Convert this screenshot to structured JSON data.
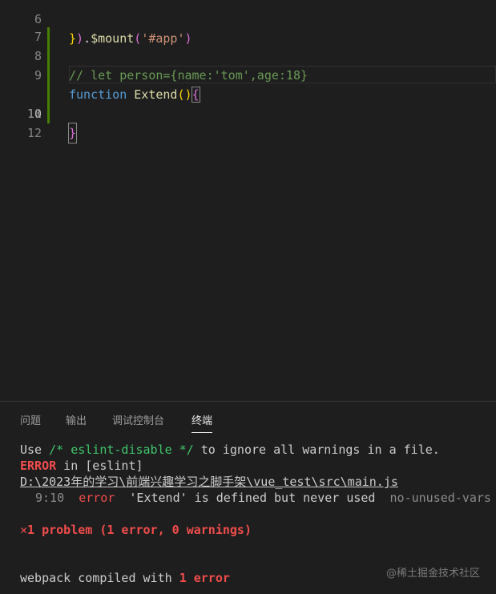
{
  "editor": {
    "partial_line": {
      "number": "6",
      "text": "}).$mount('#app')"
    },
    "lines": [
      {
        "number": "7",
        "text": ""
      },
      {
        "number": "8",
        "comment": "// let person={name:'tom',age:18}"
      },
      {
        "number": "9",
        "keyword": "function",
        "fn_name": "Extend",
        "parens": "()",
        "brace": "{"
      },
      {
        "number": "10",
        "text": ""
      },
      {
        "number": "11",
        "brace": "}"
      },
      {
        "number": "12",
        "text": ""
      }
    ]
  },
  "panel": {
    "tabs": [
      {
        "label": "问题"
      },
      {
        "label": "输出"
      },
      {
        "label": "调试控制台"
      },
      {
        "label": "终端",
        "active": true
      }
    ],
    "terminal": {
      "line1_prefix": "Use ",
      "line1_code": "/* eslint-disable */",
      "line1_suffix": " to ignore all warnings in a file.",
      "error_label": "ERROR",
      "error_suffix": " in [eslint]",
      "file_path": "D:\\2023年的学习\\前端兴趣学习之脚手架\\vue_test\\src\\main.js",
      "location": "9:10",
      "severity": "error",
      "message": "'Extend' is defined but never used",
      "rule": "no-unused-vars",
      "problem_icon": "✕",
      "problem_summary": "1 problem (1 error, 0 warnings)",
      "compiled_prefix": "webpack compiled with ",
      "compiled_errors": "1 error"
    },
    "watermark": "@稀土掘金技术社区"
  },
  "colors": {
    "background": "#1e1e1e",
    "error_red": "#f14c4c",
    "comment_green": "#6a9955",
    "keyword_blue": "#569cd6",
    "function_yellow": "#dcdcaa",
    "modified_gutter": "#487e02"
  }
}
